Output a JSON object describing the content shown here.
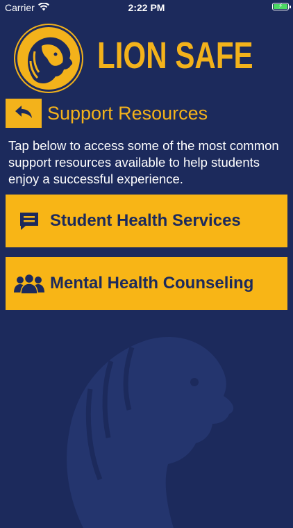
{
  "status_bar": {
    "carrier": "Carrier",
    "time": "2:22 PM",
    "icons": [
      "wifi-icon",
      "battery-charging-icon"
    ],
    "battery_color": "#4cd964"
  },
  "brand": {
    "title": "LION SAFE",
    "logo_icon": "lion-head-logo",
    "color": "#f3b21b"
  },
  "header": {
    "back_icon": "back-arrow-icon",
    "title": "Support Resources"
  },
  "intro_text": "Tap below to access some of the most common support resources available to help students enjoy a successful experience.",
  "resources": [
    {
      "icon": "chat-bubble-icon",
      "label": "Student Health Services"
    },
    {
      "icon": "group-people-icon",
      "label": "Mental Health Counseling"
    }
  ],
  "colors": {
    "background": "#1c2a5c",
    "accent": "#f8b516",
    "watermark": "#24356e"
  }
}
